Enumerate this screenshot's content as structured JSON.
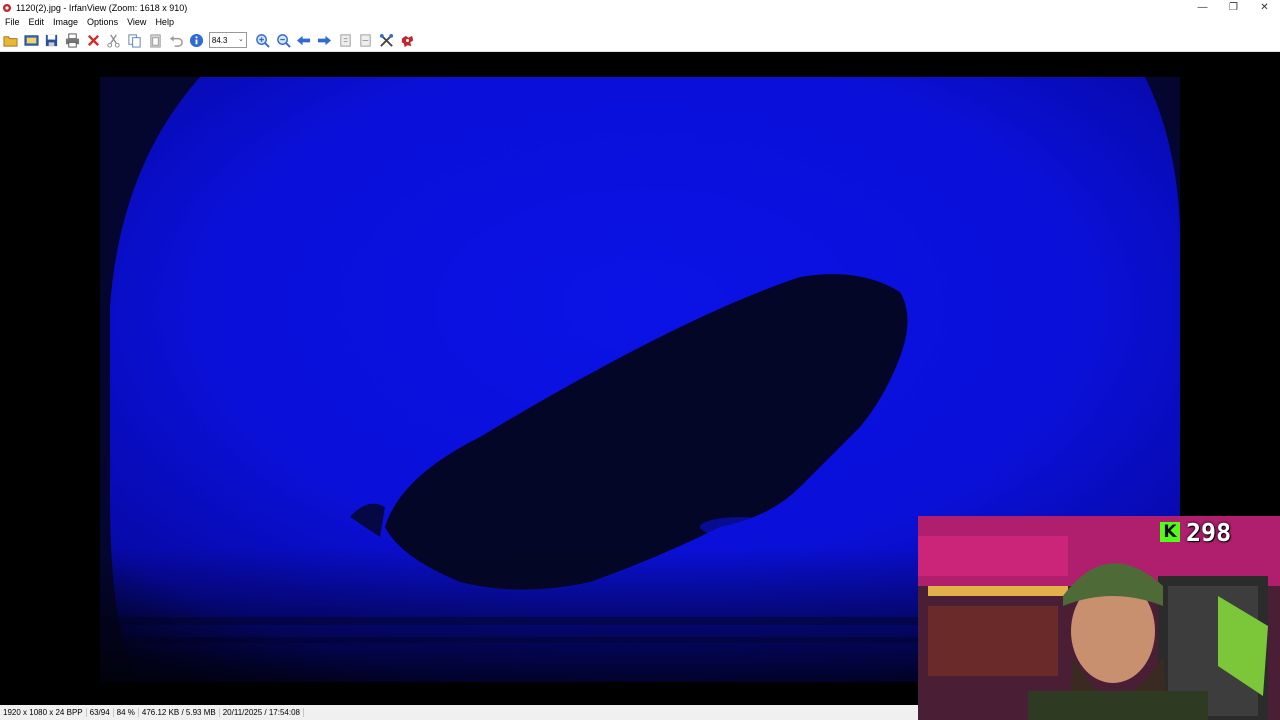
{
  "window": {
    "title": "1120(2).jpg - IrfanView (Zoom: 1618 x 910)",
    "minimize_glyph": "—",
    "restore_glyph": "❐",
    "close_glyph": "✕"
  },
  "menu": {
    "items": [
      "File",
      "Edit",
      "Image",
      "Options",
      "View",
      "Help"
    ]
  },
  "toolbar": {
    "zoom_value": "84.3",
    "buttons": [
      {
        "name": "open-icon",
        "color": "#e8b73a"
      },
      {
        "name": "thumbnails-icon",
        "color": "#3a6fb7"
      },
      {
        "name": "save-icon",
        "color": "#2a4f9e"
      },
      {
        "name": "print-icon",
        "color": "#555555"
      },
      {
        "name": "delete-icon",
        "color": "#d12a2a"
      },
      {
        "name": "cut-icon",
        "color": "#8a8a8a"
      },
      {
        "name": "copy-icon",
        "color": "#5a7fc0"
      },
      {
        "name": "paste-icon",
        "color": "#9a9a9a"
      },
      {
        "name": "undo-icon",
        "color": "#9a9a9a"
      },
      {
        "name": "info-icon",
        "color": "#2f6bd1"
      }
    ],
    "buttons_after_zoom": [
      {
        "name": "zoom-in-icon",
        "color": "#2f6bd1"
      },
      {
        "name": "zoom-out-icon",
        "color": "#2f6bd1"
      },
      {
        "name": "previous-icon",
        "color": "#2f6bd1"
      },
      {
        "name": "next-icon",
        "color": "#2f6bd1"
      },
      {
        "name": "copy-page-icon",
        "color": "#9a9a9a"
      },
      {
        "name": "move-page-icon",
        "color": "#9a9a9a"
      },
      {
        "name": "properties-icon",
        "color": "#444444"
      },
      {
        "name": "irfanview-icon",
        "color": "#c1272d"
      }
    ]
  },
  "status": {
    "resolution": "1920 x 1080 x 24 BPP",
    "index": "63/94",
    "zoom": "84 %",
    "size": "476.12 KB / 5.93 MB",
    "datetime": "20/11/2025 / 17:54:08"
  },
  "overlay": {
    "kick_letter": "K",
    "viewer_count": "298",
    "kick_color": "#53fc18"
  }
}
